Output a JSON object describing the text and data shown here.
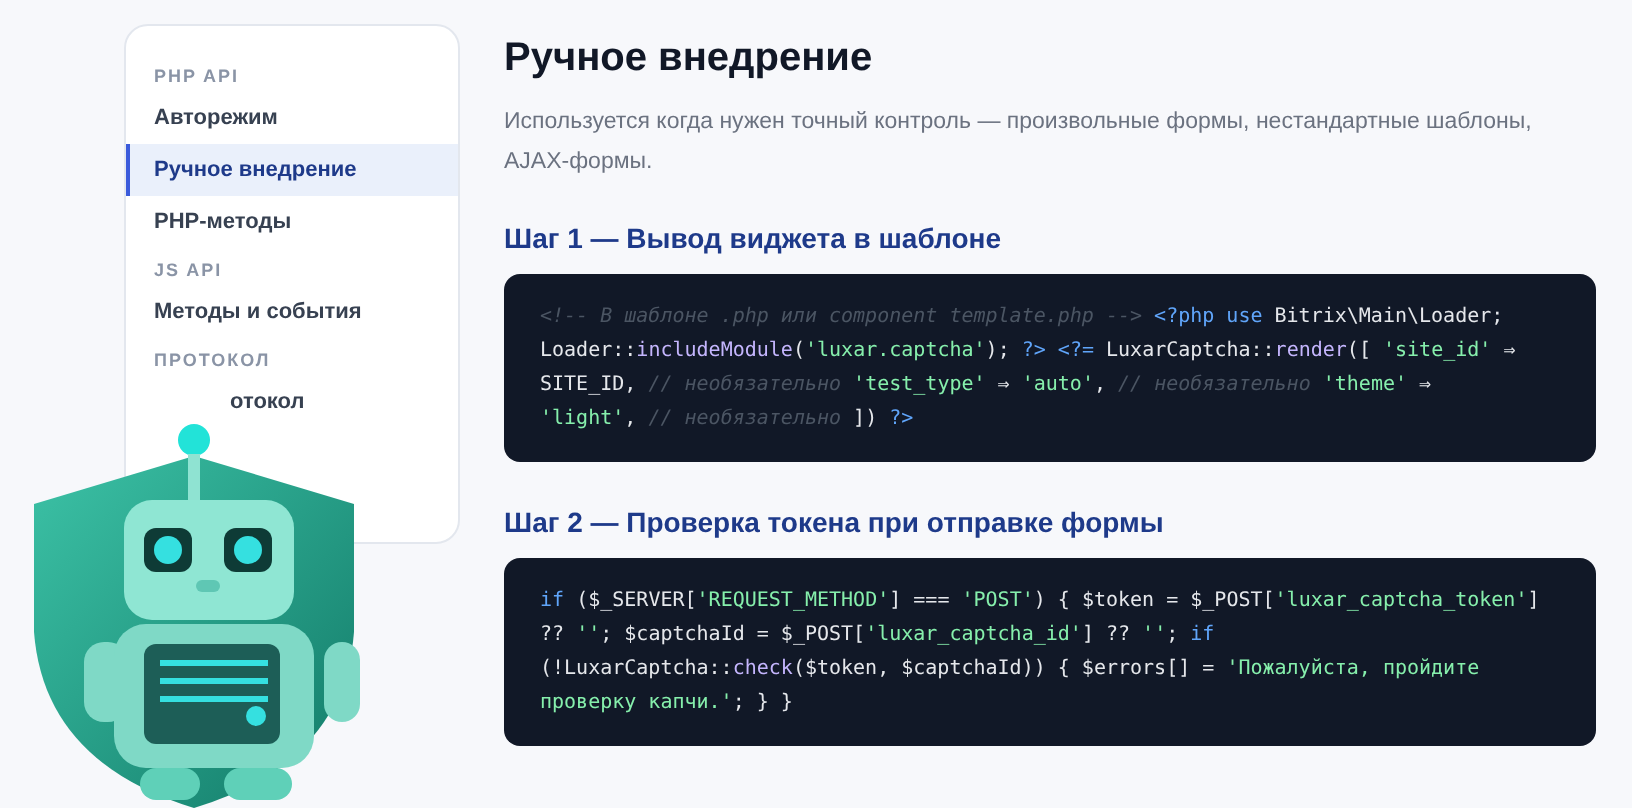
{
  "sidebar": {
    "items": [
      {
        "kind": "heading",
        "label": "PHP API"
      },
      {
        "kind": "link",
        "label": "Авторежим",
        "selected": false
      },
      {
        "kind": "link",
        "label": "Ручное внедрение",
        "selected": true
      },
      {
        "kind": "link",
        "label": "PHP-методы",
        "selected": false
      },
      {
        "kind": "heading",
        "label": "JS API"
      },
      {
        "kind": "link",
        "label": "Методы и события",
        "selected": false
      },
      {
        "kind": "heading",
        "label": "ПРОТОКОЛ"
      },
      {
        "kind": "partial",
        "label": "отокол",
        "selected": false
      }
    ]
  },
  "page": {
    "title": "Ручное внедрение",
    "description": "Используется когда нужен точный контроль — произвольные формы, нестандартные шаблоны, AJAX-формы.",
    "steps": [
      {
        "heading": "Шаг 1 — Вывод виджета в шаблоне",
        "code": [
          [
            {
              "kind": "comment",
              "text": "<!-- В шаблоне .php или component template.php --> "
            },
            {
              "kind": "keyword",
              "text": "<?php use"
            },
            {
              "kind": "plain",
              "text": " Bitrix\\Main\\Loader;"
            }
          ],
          [
            {
              "kind": "plain",
              "text": "Loader::"
            },
            {
              "kind": "func",
              "text": "includeModule"
            },
            {
              "kind": "plain",
              "text": "("
            },
            {
              "kind": "string",
              "text": "'luxar.captcha'"
            },
            {
              "kind": "plain",
              "text": "); "
            },
            {
              "kind": "keyword",
              "text": "?> <?="
            },
            {
              "kind": "plain",
              "text": " LuxarCaptcha::"
            },
            {
              "kind": "func",
              "text": "render"
            },
            {
              "kind": "plain",
              "text": "([ "
            },
            {
              "kind": "string",
              "text": "'site_id'"
            },
            {
              "kind": "plain",
              "text": " ⇒"
            }
          ],
          [
            {
              "kind": "plain",
              "text": "SITE_ID, "
            },
            {
              "kind": "comment",
              "text": "// необязательно "
            },
            {
              "kind": "string",
              "text": "'test_type'"
            },
            {
              "kind": "plain",
              "text": " ⇒ "
            },
            {
              "kind": "string",
              "text": "'auto'"
            },
            {
              "kind": "plain",
              "text": ", "
            },
            {
              "kind": "comment",
              "text": "// необязательно "
            },
            {
              "kind": "string",
              "text": "'theme'"
            },
            {
              "kind": "plain",
              "text": " ⇒"
            }
          ],
          [
            {
              "kind": "string",
              "text": "'light'"
            },
            {
              "kind": "plain",
              "text": ", "
            },
            {
              "kind": "comment",
              "text": "// необязательно"
            },
            {
              "kind": "plain",
              "text": " ]) "
            },
            {
              "kind": "keyword",
              "text": "?>"
            }
          ]
        ]
      },
      {
        "heading": "Шаг 2 — Проверка токена при отправке формы",
        "code": [
          [
            {
              "kind": "keyword",
              "text": "if"
            },
            {
              "kind": "plain",
              "text": " ($_SERVER["
            },
            {
              "kind": "string",
              "text": "'REQUEST_METHOD'"
            },
            {
              "kind": "plain",
              "text": "] === "
            },
            {
              "kind": "string",
              "text": "'POST'"
            },
            {
              "kind": "plain",
              "text": ") { $token = $_POST["
            },
            {
              "kind": "string",
              "text": "'luxar_captcha_token'"
            },
            {
              "kind": "plain",
              "text": "]"
            }
          ],
          [
            {
              "kind": "plain",
              "text": "?? "
            },
            {
              "kind": "string",
              "text": "''"
            },
            {
              "kind": "plain",
              "text": "; $captchaId = $_POST["
            },
            {
              "kind": "string",
              "text": "'luxar_captcha_id'"
            },
            {
              "kind": "plain",
              "text": "] ?? "
            },
            {
              "kind": "string",
              "text": "''"
            },
            {
              "kind": "plain",
              "text": "; "
            },
            {
              "kind": "keyword",
              "text": "if"
            }
          ],
          [
            {
              "kind": "plain",
              "text": "(!LuxarCaptcha::"
            },
            {
              "kind": "func",
              "text": "check"
            },
            {
              "kind": "plain",
              "text": "($token, $captchaId)) { $errors[] = "
            },
            {
              "kind": "string",
              "text": "'Пожалуйста, пройдите"
            }
          ],
          [
            {
              "kind": "string",
              "text": "проверку капчи.'"
            },
            {
              "kind": "plain",
              "text": "; } }"
            }
          ]
        ]
      }
    ]
  }
}
